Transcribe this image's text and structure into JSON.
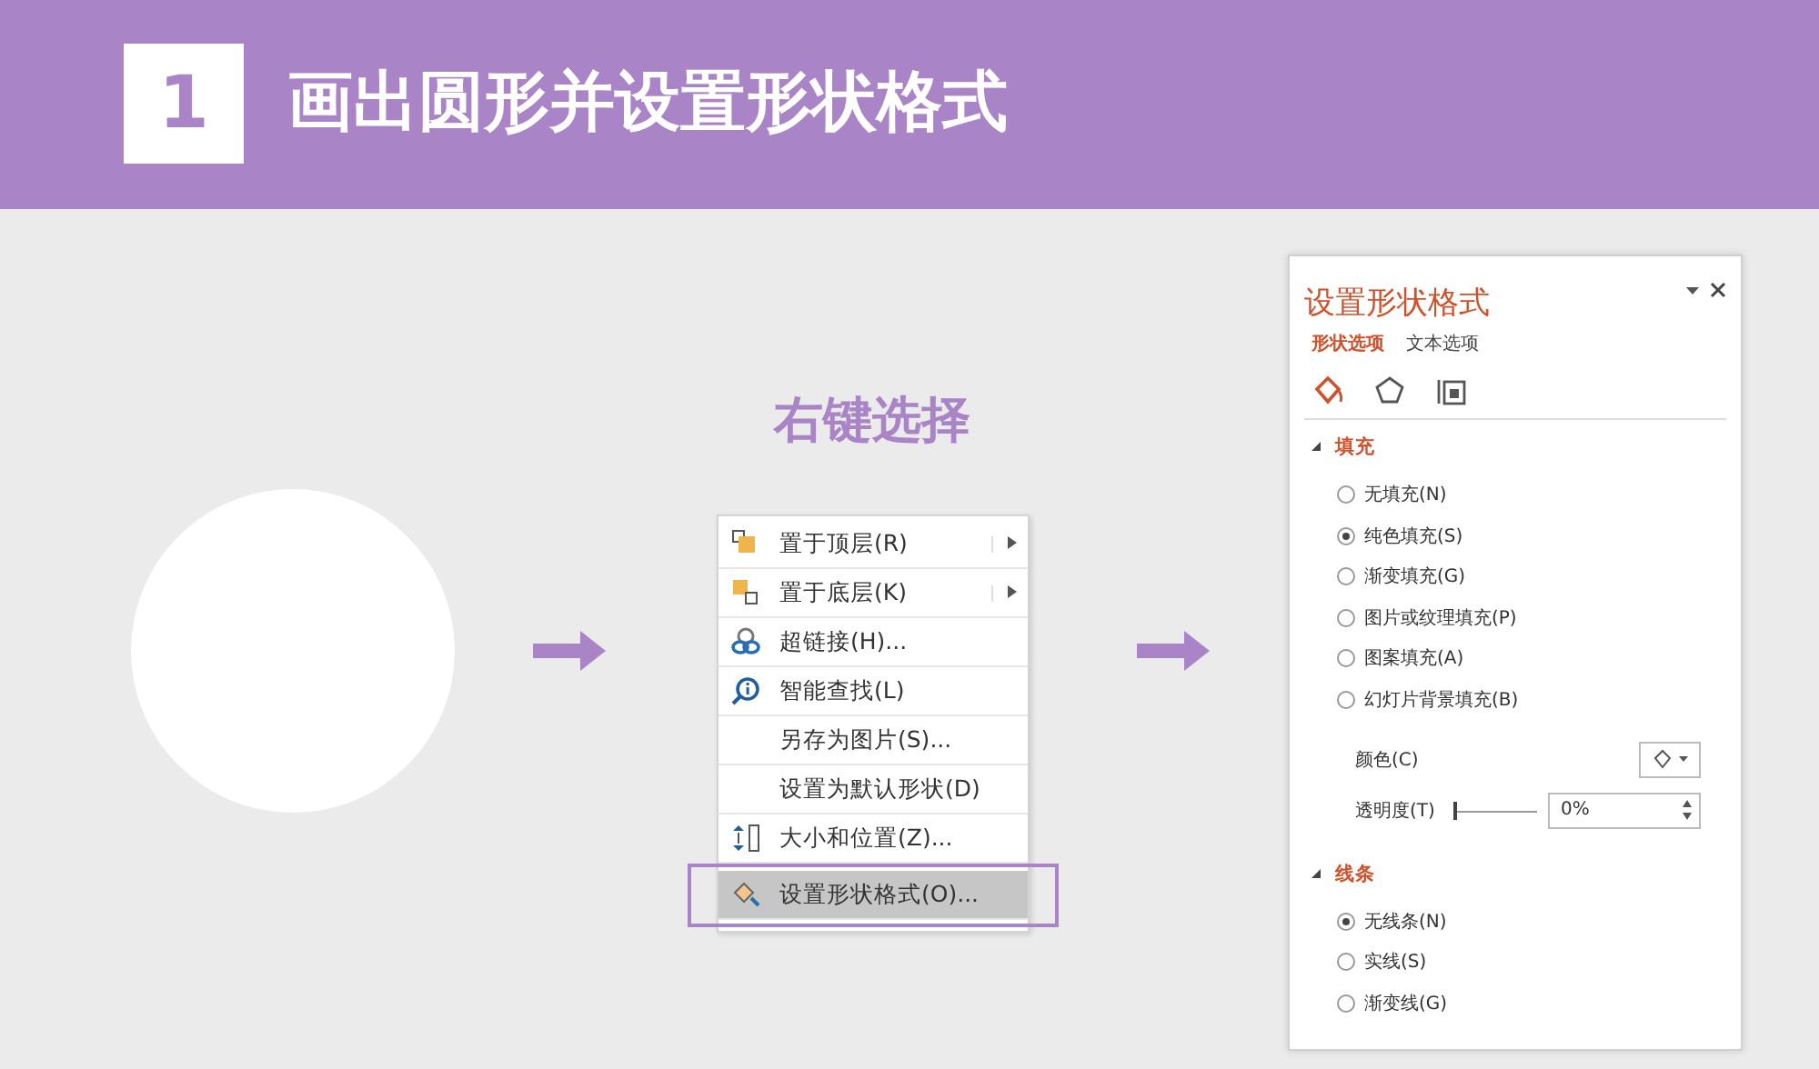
{
  "header": {
    "number": "1",
    "title": "画出圆形并设置形状格式"
  },
  "caption": "右键选择",
  "context_menu": {
    "items": [
      {
        "label": "置于顶层(R)",
        "kind": "bring-front",
        "submenu": true,
        "selected": false
      },
      {
        "label": "置于底层(K)",
        "kind": "send-back",
        "submenu": true,
        "selected": false
      },
      {
        "label": "超链接(H)...",
        "kind": "link",
        "submenu": false,
        "selected": false
      },
      {
        "label": "智能查找(L)",
        "kind": "lookup",
        "submenu": false,
        "selected": false
      },
      {
        "label": "另存为图片(S)...",
        "kind": "plain",
        "submenu": false,
        "selected": false
      },
      {
        "label": "设置为默认形状(D)",
        "kind": "plain",
        "submenu": false,
        "selected": false
      },
      {
        "label": "大小和位置(Z)...",
        "kind": "size",
        "submenu": false,
        "selected": false
      },
      {
        "label": "设置形状格式(O)...",
        "kind": "format",
        "submenu": false,
        "selected": true
      }
    ]
  },
  "pane": {
    "title": "设置形状格式",
    "tabs": [
      {
        "label": "形状选项",
        "selected": true
      },
      {
        "label": "文本选项",
        "selected": false
      }
    ],
    "icon_tabs": [
      {
        "kind": "fill",
        "selected": true
      },
      {
        "kind": "effects",
        "selected": false
      },
      {
        "kind": "size",
        "selected": false
      }
    ],
    "sections": [
      {
        "title": "填充",
        "expanded": true,
        "options": [
          {
            "label": "无填充(N)",
            "selected": false
          },
          {
            "label": "纯色填充(S)",
            "selected": true
          },
          {
            "label": "渐变填充(G)",
            "selected": false
          },
          {
            "label": "图片或纹理填充(P)",
            "selected": false
          },
          {
            "label": "图案填充(A)",
            "selected": false
          },
          {
            "label": "幻灯片背景填充(B)",
            "selected": false
          }
        ],
        "color_label": "颜色(C)",
        "transparency": {
          "label": "透明度(T)",
          "level": 0,
          "value": "0%"
        }
      },
      {
        "title": "线条",
        "expanded": true,
        "options": [
          {
            "label": "无线条(N)",
            "selected": true
          },
          {
            "label": "实线(S)",
            "selected": false
          },
          {
            "label": "渐变线(G)",
            "selected": false
          }
        ]
      }
    ]
  }
}
